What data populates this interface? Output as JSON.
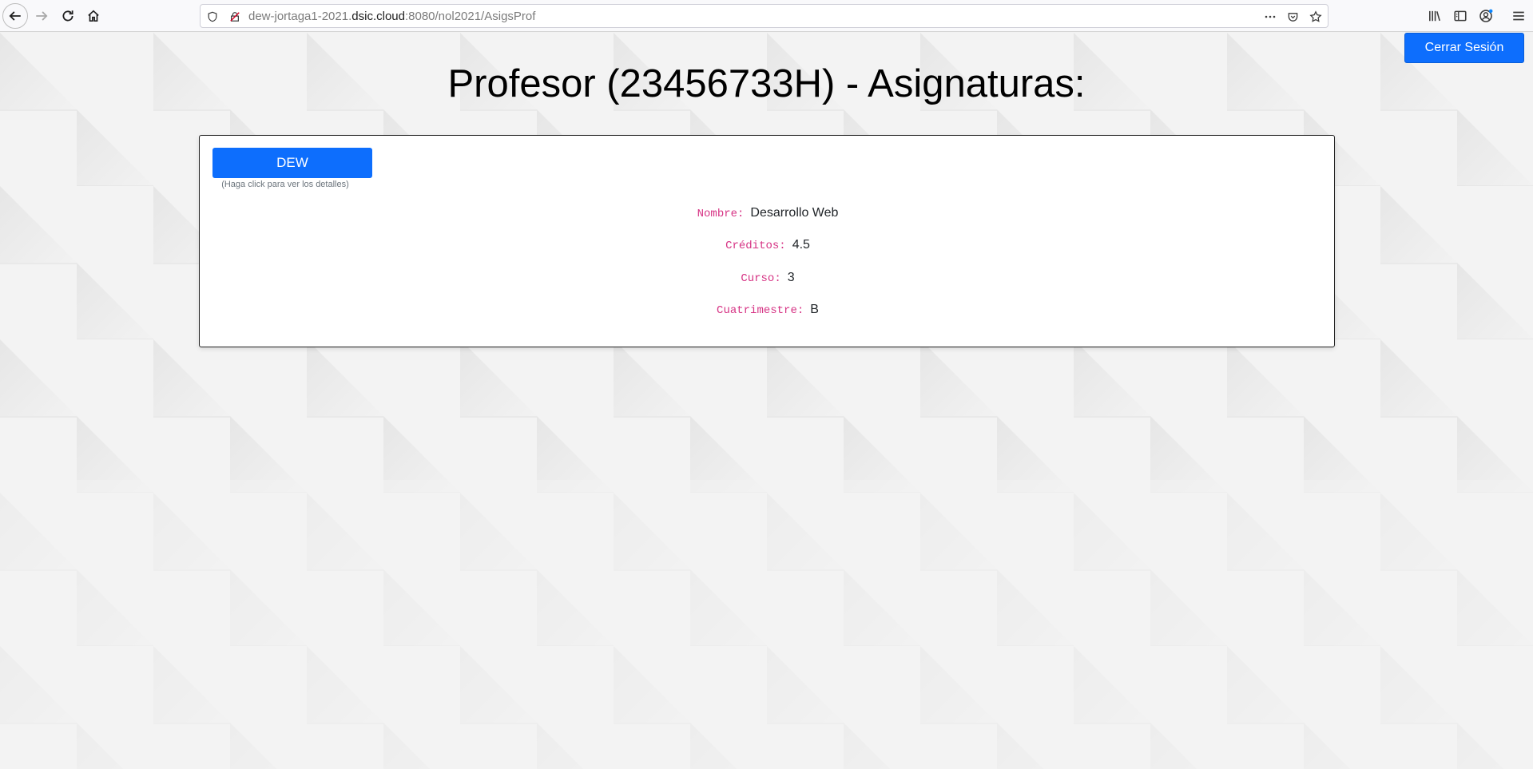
{
  "browser": {
    "url": {
      "prefix": "dew-jortaga1-2021.",
      "domain": "dsic.cloud",
      "suffix": ":8080/nol2021/AsigsProf"
    }
  },
  "header": {
    "title": "Profesor (23456733H) - Asignaturas:",
    "logout_label": "Cerrar Sesión"
  },
  "subject": {
    "button_label": "DEW",
    "hint": "(Haga click para ver los detalles)",
    "details": [
      {
        "label": "Nombre:",
        "value": "Desarrollo Web"
      },
      {
        "label": "Créditos:",
        "value": "4.5"
      },
      {
        "label": "Curso:",
        "value": "3"
      },
      {
        "label": "Cuatrimestre:",
        "value": "B"
      }
    ]
  },
  "colors": {
    "primary": "#0d6efd",
    "label": "#d63384",
    "background": "#f2f2f2"
  }
}
